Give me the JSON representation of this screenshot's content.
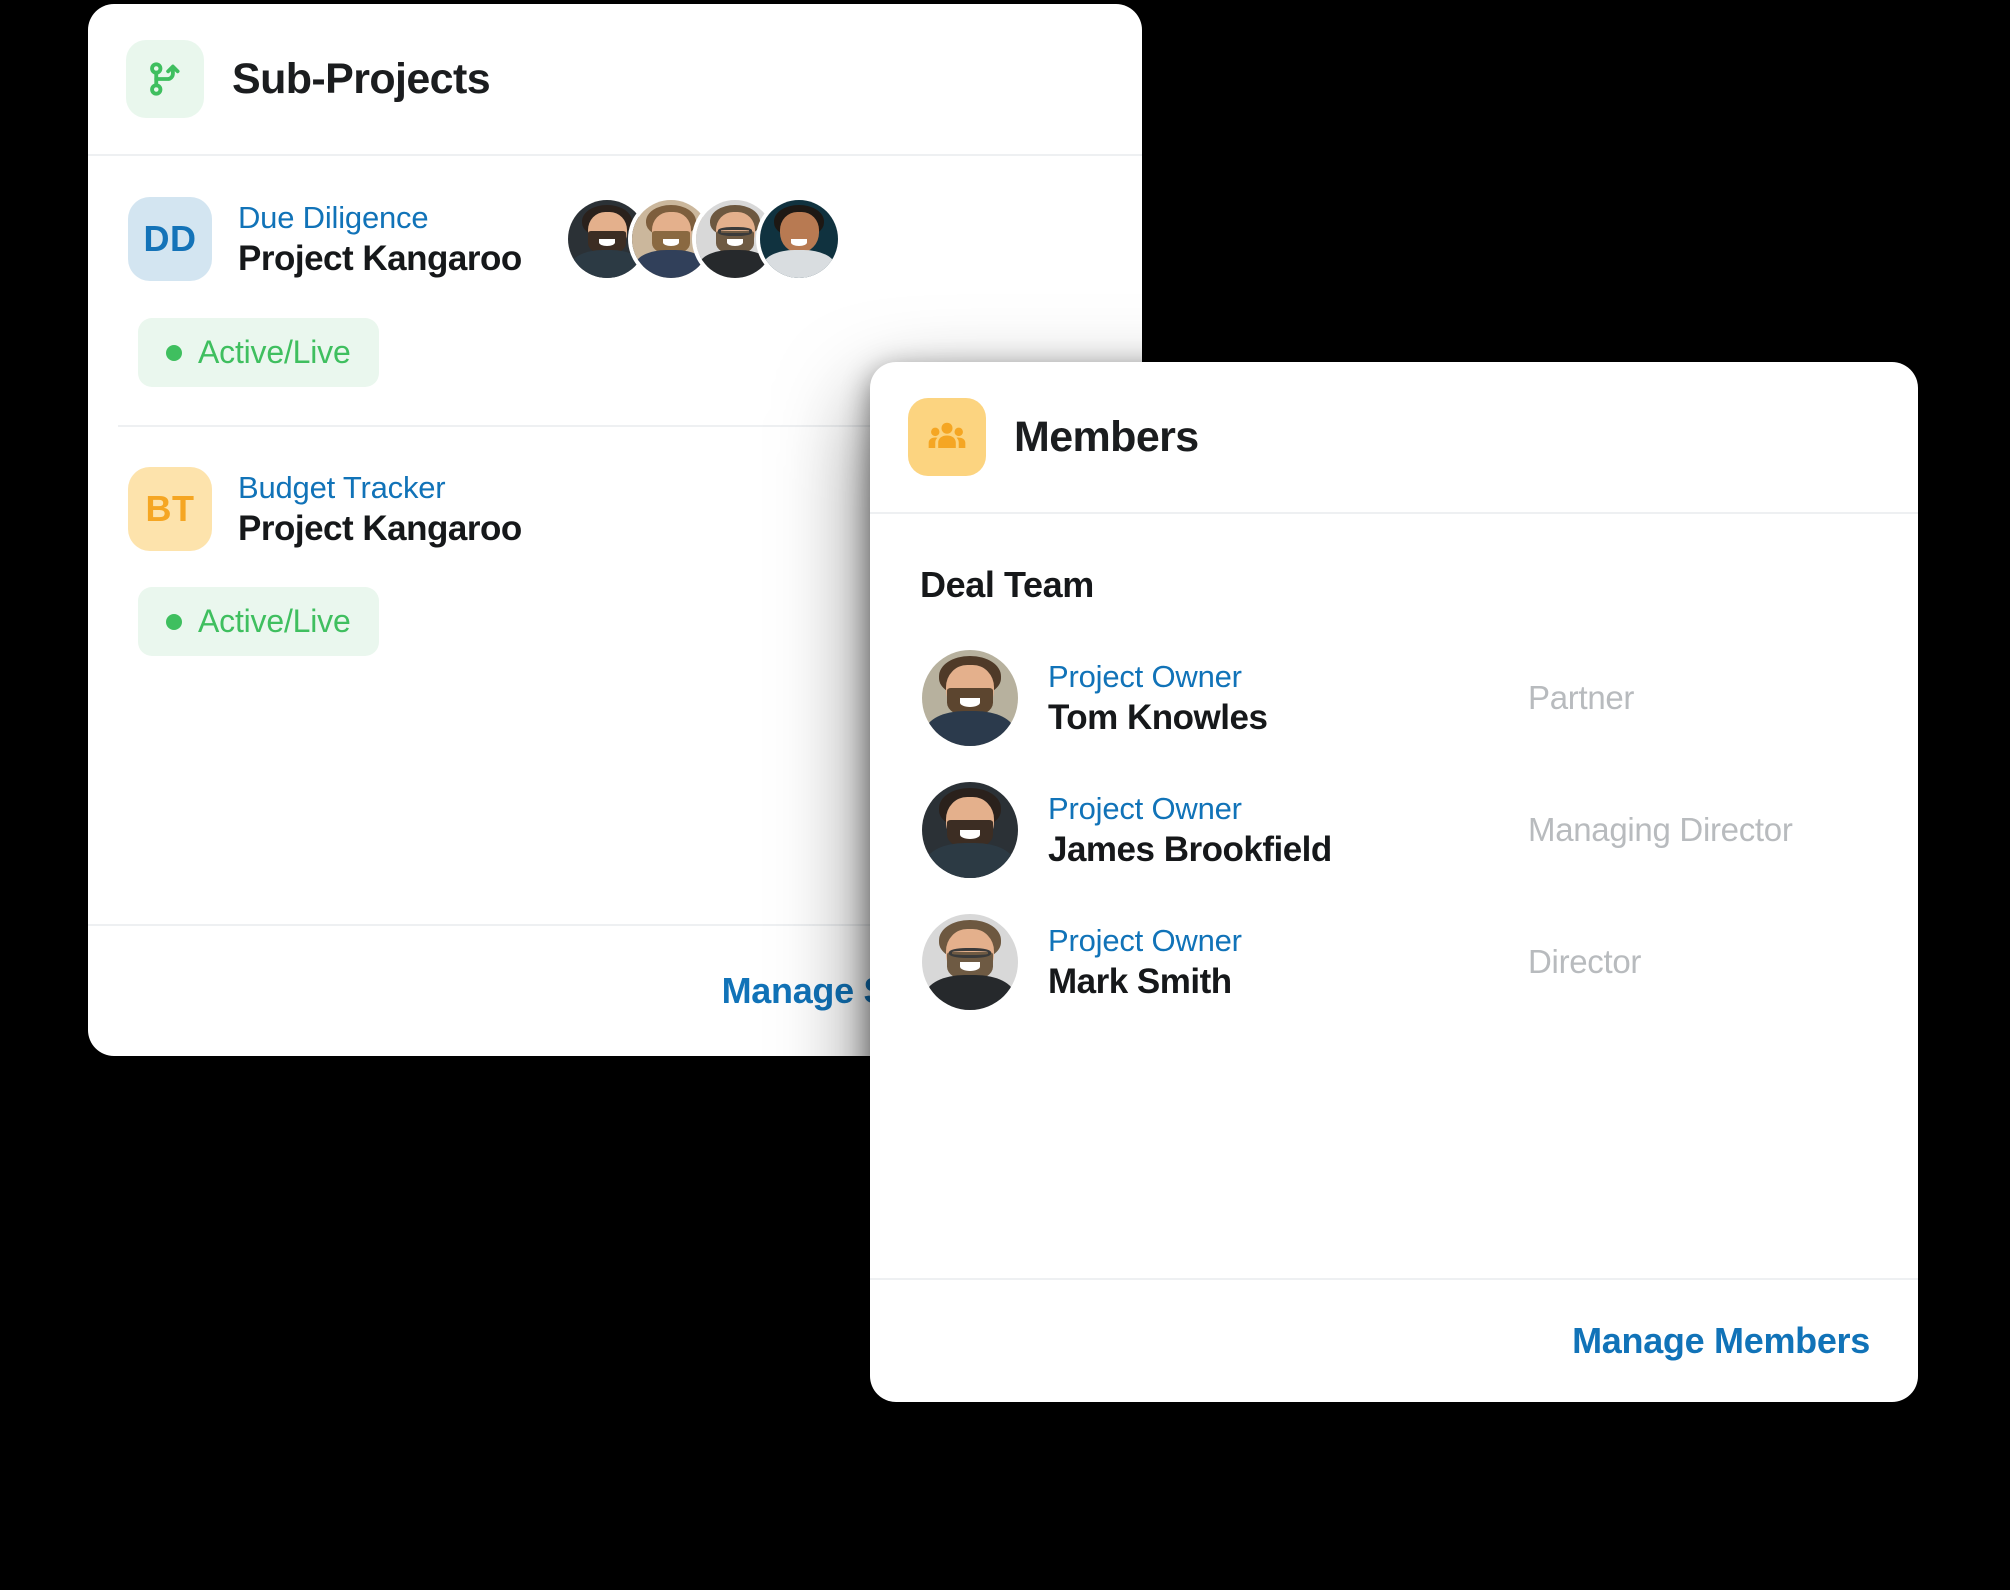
{
  "subprojects": {
    "title": "Sub-Projects",
    "icon": "git-branch-icon",
    "icon_color": "#3fbf5f",
    "rows": [
      {
        "initials": "DD",
        "kicker": "Due Diligence",
        "name": "Project Kangaroo",
        "status": "Active/Live",
        "status_color": "#3fbf5f",
        "avatar_count": 4
      },
      {
        "initials": "BT",
        "kicker": "Budget Tracker",
        "name": "Project Kangaroo",
        "status": "Active/Live",
        "status_color": "#3fbf5f",
        "avatar_count": 0
      }
    ],
    "footer_link": "Manage Sub-Projects"
  },
  "members": {
    "title": "Members",
    "icon": "people-group-icon",
    "icon_color": "#f5a623",
    "section_title": "Deal Team",
    "rows": [
      {
        "kicker": "Project Owner",
        "name": "Tom Knowles",
        "role": "Partner"
      },
      {
        "kicker": "Project Owner",
        "name": "James Brookfield",
        "role": "Managing Director"
      },
      {
        "kicker": "Project Owner",
        "name": "Mark Smith",
        "role": "Director"
      }
    ],
    "footer_link": "Manage Members"
  },
  "colors": {
    "background": "#000000",
    "card": "#ffffff",
    "link_blue": "#1173b8",
    "status_green": "#3fbf5f",
    "role_grey": "#b8bbbe",
    "amber": "#f5a623"
  }
}
